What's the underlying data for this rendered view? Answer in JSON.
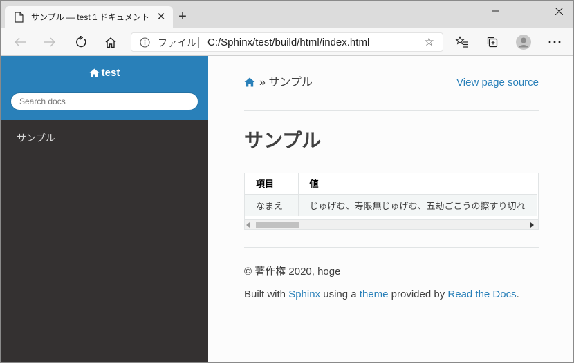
{
  "browser": {
    "tab_title": "サンプル — test 1 ドキュメント",
    "tab_close": "✕",
    "new_tab": "+",
    "address_label": "ファイル",
    "url": "C:/Sphinx/test/build/html/index.html",
    "star": "☆"
  },
  "sidebar": {
    "project_name": "test",
    "search_placeholder": "Search docs",
    "nav_items": [
      "サンプル"
    ]
  },
  "content": {
    "breadcrumb_sep": "»",
    "breadcrumb_current": "サンプル",
    "view_source": "View page source",
    "heading": "サンプル",
    "table": {
      "headers": [
        "項目",
        "値"
      ],
      "rows": [
        [
          "なまえ",
          "じゅげむ、寿限無じゅげむ、五劫ごこうの擦すり切れ"
        ]
      ]
    },
    "footer": {
      "copyright": "© 著作権 2020, hoge",
      "built_prefix": "Built with ",
      "sphinx": "Sphinx",
      "built_mid1": " using a ",
      "theme": "theme",
      "built_mid2": " provided by ",
      "rtd": "Read the Docs",
      "built_suffix": "."
    }
  },
  "colors": {
    "accent": "#2980b9",
    "sidebar_bg": "#343131",
    "link": "#2980b9"
  },
  "icons": [
    "page-icon",
    "close-icon",
    "minimize-icon",
    "maximize-icon",
    "window-close-icon",
    "back-icon",
    "forward-icon",
    "refresh-icon",
    "home-icon",
    "info-icon",
    "star-icon",
    "favorites-icon",
    "collections-icon",
    "profile-icon",
    "more-icon"
  ]
}
